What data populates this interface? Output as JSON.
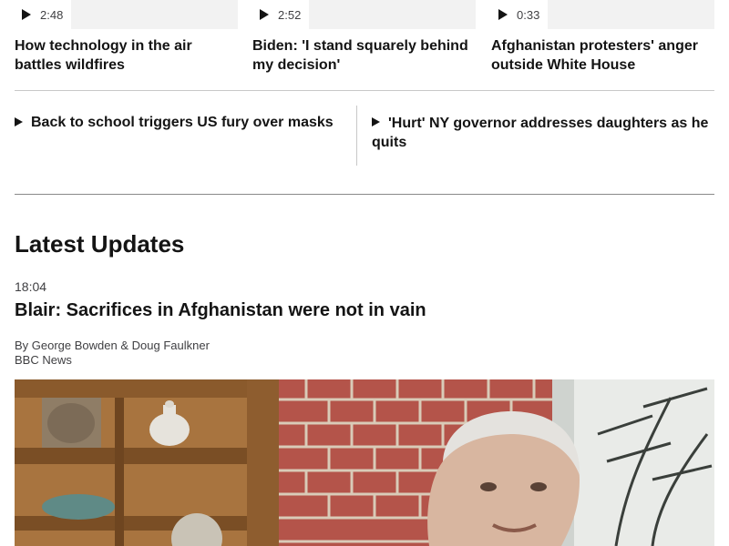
{
  "videos": [
    {
      "duration": "2:48",
      "title": "How technology in the air battles wildfires"
    },
    {
      "duration": "2:52",
      "title": "Biden: 'I stand squarely behind my decision'"
    },
    {
      "duration": "0:33",
      "title": "Afghanistan protesters' anger outside White House"
    }
  ],
  "related": [
    {
      "label": "Back to school triggers US fury over masks"
    },
    {
      "label": "'Hurt' NY governor addresses daughters as he quits"
    }
  ],
  "latest": {
    "heading": "Latest Updates",
    "time": "18:04",
    "headline": "Blair: Sacrifices in Afghanistan were not in vain",
    "byline": "By George Bowden & Doug Faulkner",
    "source": "BBC News"
  },
  "colors": {
    "text": "#141414",
    "muted": "#3f3f42",
    "divider": "#c8c8c8"
  },
  "icons": {
    "play": "play-icon"
  }
}
